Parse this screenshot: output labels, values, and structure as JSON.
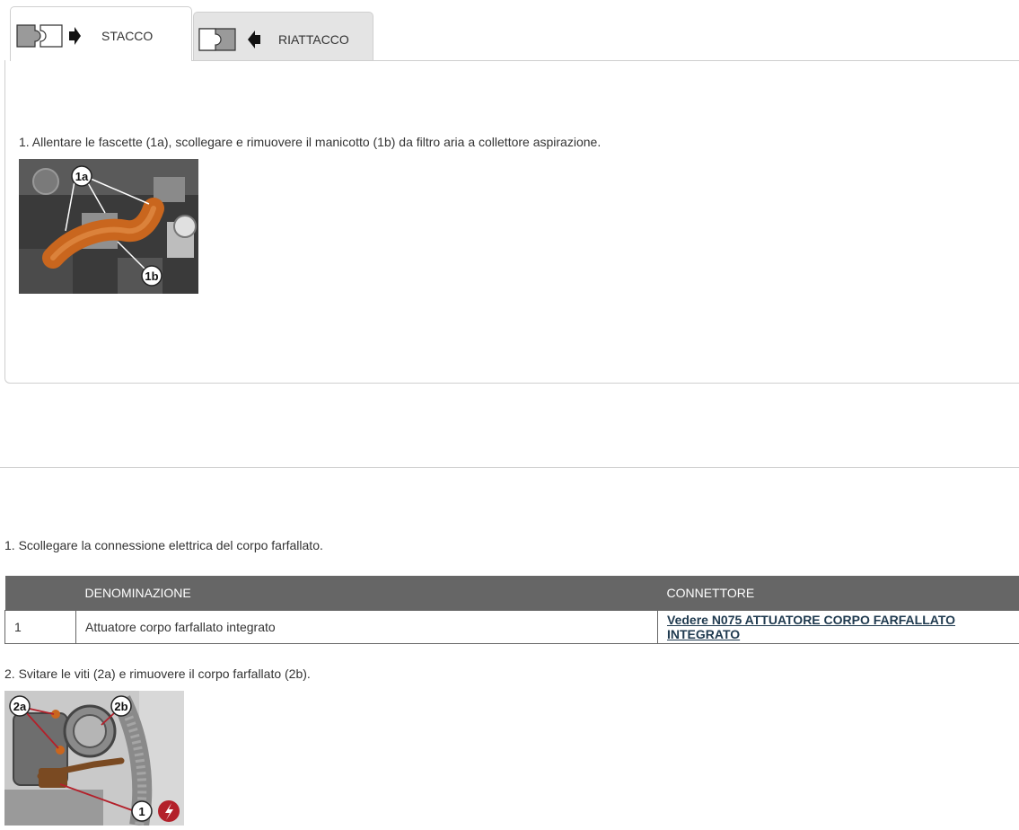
{
  "tabs": [
    {
      "label": "STACCO",
      "active": true,
      "icon": "disconnect-icon"
    },
    {
      "label": "RIATTACCO",
      "active": false,
      "icon": "reconnect-icon"
    }
  ],
  "section1": {
    "step1": "1. Allentare le fascette (1a), scollegare e rimuovere il manicotto (1b) da filtro aria a collettore aspirazione.",
    "image1": {
      "callouts": [
        "1a",
        "1b"
      ]
    }
  },
  "section2": {
    "step1": "1. Scollegare la connessione elettrica del corpo farfallato.",
    "table": {
      "headers": [
        "",
        "DENOMINAZIONE",
        "CONNETTORE"
      ],
      "rows": [
        {
          "num": "1",
          "name": "Attuatore corpo farfallato integrato",
          "link": "Vedere N075 ATTUATORE CORPO FARFALLATO INTEGRATO"
        }
      ]
    },
    "step2": "2. Svitare le viti (2a) e rimuovere il corpo farfallato (2b).",
    "image2": {
      "callouts": [
        "2a",
        "2b",
        "1"
      ]
    }
  },
  "colors": {
    "header_bg": "#666666",
    "hose_orange": "#c9661e",
    "warning_red": "#b3202a",
    "link": "#1f3a4f"
  }
}
